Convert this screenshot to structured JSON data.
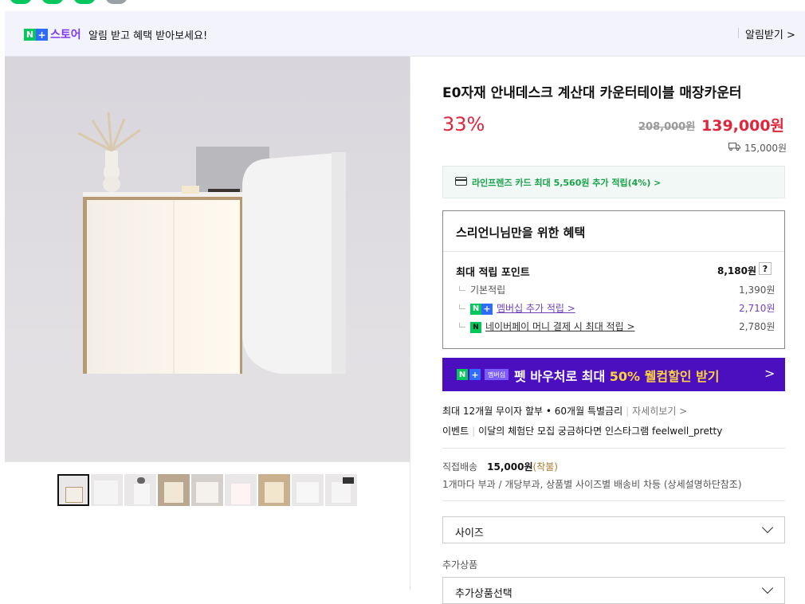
{
  "banner": {
    "store": "스토어",
    "text": "알림 받고 혜택 받아보세요!",
    "alarm": "알림받기 >"
  },
  "product": {
    "title": "E0자재 안내데스크 계산대 카운터테이블 매장카운터",
    "discount": "33%",
    "original_price": "208,000원",
    "price": "139,000원",
    "shipping_fee": "15,000원"
  },
  "card": {
    "text": "라인프렌즈 카드 최대 5,560원 추가 적립(4%) >"
  },
  "benefit": {
    "title": "스리언니님만을 위한 혜택",
    "max_points_label": "최대 적립 포인트",
    "max_points_value": "8,180원",
    "help": "?",
    "rows": [
      {
        "label": "기본적립",
        "value": "1,390원"
      },
      {
        "label": "멤버십 추가 적립 >",
        "value": "2,710원"
      },
      {
        "label": "네이버페이 머니 결제 시 최대 적립 >",
        "value": "2,780원"
      }
    ]
  },
  "promo": {
    "tag": "멤버십",
    "text_pre": "펫 바우처로 최대 ",
    "text_hl": "50% 웰컴할인 받기",
    "arrow": ">"
  },
  "info": {
    "installment": "최대 12개월 무이자 할부 • 60개월 특별금리",
    "installment_more": "자세히보기 >",
    "event_label": "이벤트",
    "event_text": "이달의 체험단 모집 궁금하다면 인스타그램 feelwell_pretty"
  },
  "delivery": {
    "label": "직접배송",
    "fee": "15,000원",
    "fee_note": "(착불)",
    "detail": "1개마다 부과 / 개당부과, 상품별 사이즈별 배송비 차등 (상세설명하단참조)"
  },
  "options": {
    "size_label": "사이즈",
    "additional_label": "추가상품",
    "additional_select": "추가상품선택"
  },
  "colors": {
    "accent_red": "#e0263b",
    "naver_green": "#03c75a",
    "promo_purple": "#4b0fbf"
  }
}
